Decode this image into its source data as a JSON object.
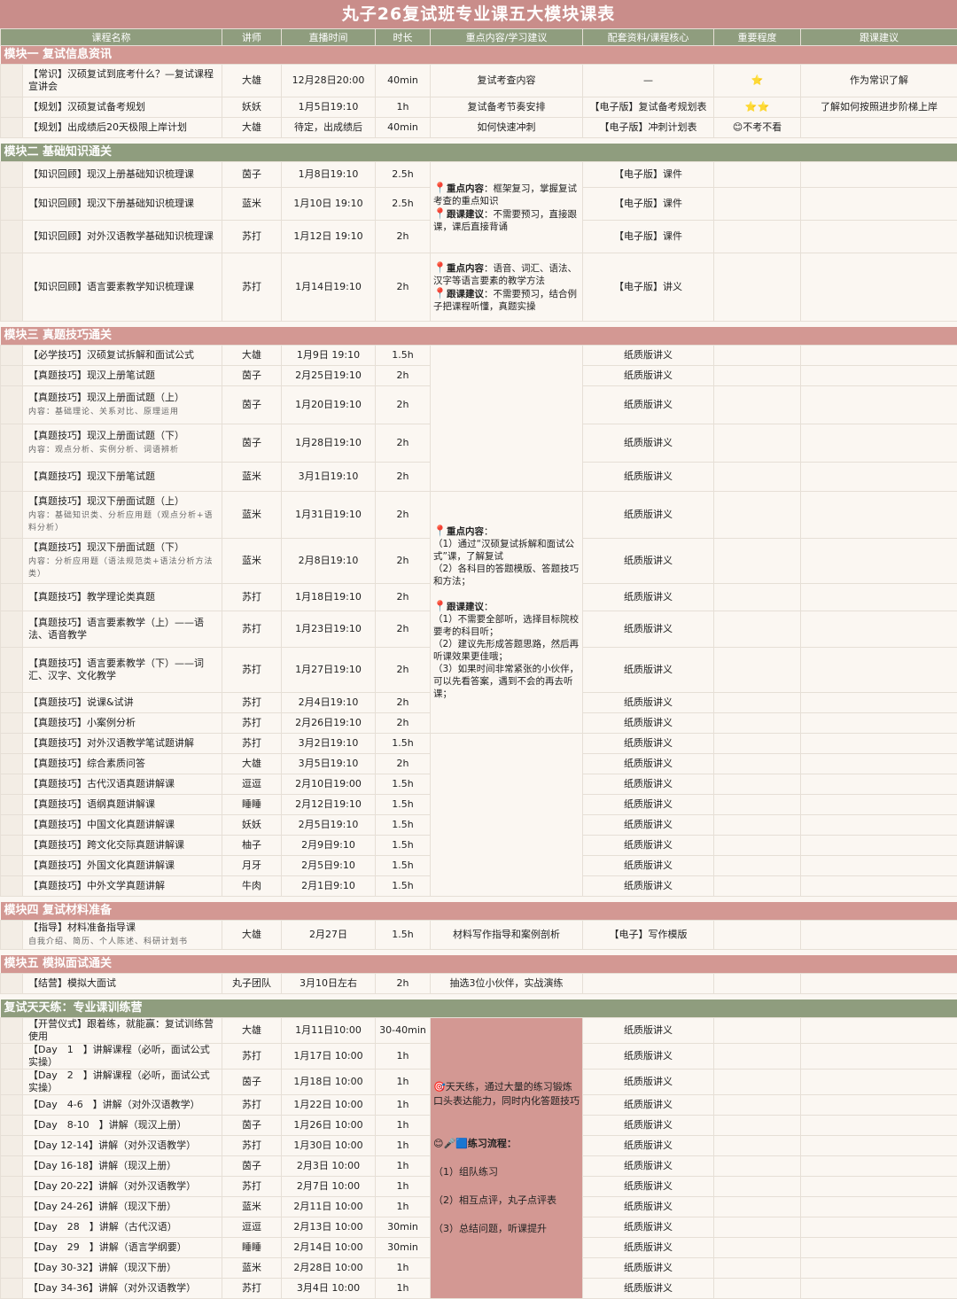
{
  "title": "丸子26复试班专业课五大模块课表",
  "headers": [
    "课程名称",
    "讲师",
    "直播时间",
    "时长",
    "重点内容/学习建议",
    "配套资料/课程核心",
    "重要程度",
    "跟课建议"
  ],
  "module1": {
    "title": "模块一  复试信息资讯",
    "rows": [
      {
        "name": "【常识】汉硕复试到底考什么？—复试课程宣讲会",
        "teacher": "大雄",
        "time": "12月28日20:00",
        "dur": "40min",
        "content": "复试考查内容",
        "material": "—",
        "importance": "⭐",
        "advice": "作为常识了解"
      },
      {
        "name": "【规划】汉硕复试备考规划",
        "teacher": "妖妖",
        "time": "1月5日19:10",
        "dur": "1h",
        "content": "复试备考节奏安排",
        "material": "【电子版】复试备考规划表",
        "importance": "⭐⭐",
        "advice": "了解如何按照进步阶梯上岸"
      },
      {
        "name": "【规划】出成绩后20天极限上岸计划",
        "teacher": "大雄",
        "time": "待定，出成绩后",
        "dur": "40min",
        "content": "如何快速冲刺",
        "material": "【电子版】冲刺计划表",
        "importance": "😊不考不看",
        "advice": ""
      }
    ]
  },
  "module2": {
    "title": "模块二  基础知识通关",
    "rows": [
      {
        "name": "【知识回顾】现汉上册基础知识梳理课",
        "teacher": "茵子",
        "time": "1月8日19:10",
        "dur": "2.5h",
        "material": "【电子版】课件"
      },
      {
        "name": "【知识回顾】现汉下册基础知识梳理课",
        "teacher": "蓝米",
        "time": "1月10日 19:10",
        "dur": "2.5h",
        "material": "【电子版】课件"
      },
      {
        "name": "【知识回顾】对外汉语教学基础知识梳理课",
        "teacher": "苏打",
        "time": "1月12日 19:10",
        "dur": "2h",
        "material": "【电子版】课件"
      },
      {
        "name": "【知识回顾】语言要素教学知识梳理课",
        "teacher": "苏打",
        "time": "1月14日19:10",
        "dur": "2h",
        "material": "【电子版】讲义"
      }
    ],
    "note1": {
      "k1": "重点内容",
      "v1": "：框架复习，掌握复试考查的重点知识",
      "k2": "跟课建议",
      "v2": "：不需要预习，直接跟课，课后直接背诵"
    },
    "note2": {
      "k1": "重点内容",
      "v1": "：语音、词汇、语法、汉字等语言要素的教学方法",
      "k2": "跟课建议",
      "v2": "：不需要预习，结合例子把课程听懂，真题实操"
    }
  },
  "module3": {
    "title": "模块三  真题技巧通关",
    "rows": [
      {
        "name": "【必学技巧】汉硕复试拆解和面试公式",
        "sub": "",
        "teacher": "大雄",
        "time": "1月9日 19:10",
        "dur": "1.5h",
        "material": "纸质版讲义"
      },
      {
        "name": "【真题技巧】现汉上册笔试题",
        "sub": "",
        "teacher": "茵子",
        "time": "2月25日19:10",
        "dur": "2h",
        "material": "纸质版讲义"
      },
      {
        "name": "【真题技巧】现汉上册面试题（上）",
        "sub": "内容：基础理论、关系对比、原理运用",
        "teacher": "茵子",
        "time": "1月20日19:10",
        "dur": "2h",
        "material": "纸质版讲义"
      },
      {
        "name": "【真题技巧】现汉上册面试题（下）",
        "sub": "内容：观点分析、实例分析、词语辨析",
        "teacher": "茵子",
        "time": "1月28日19:10",
        "dur": "2h",
        "material": "纸质版讲义"
      },
      {
        "name": "【真题技巧】现汉下册笔试题",
        "sub": "",
        "teacher": "蓝米",
        "time": "3月1日19:10",
        "dur": "2h",
        "material": "纸质版讲义"
      },
      {
        "name": "【真题技巧】现汉下册面试题（上）",
        "sub": "内容：基础知识类、分析应用题（观点分析+语料分析）",
        "teacher": "蓝米",
        "time": "1月31日19:10",
        "dur": "2h",
        "material": "纸质版讲义"
      },
      {
        "name": "【真题技巧】现汉下册面试题（下）",
        "sub": "内容：分析应用题（语法规范类+语法分析方法类）",
        "teacher": "蓝米",
        "time": "2月8日19:10",
        "dur": "2h",
        "material": "纸质版讲义"
      },
      {
        "name": "【真题技巧】教学理论类真题",
        "sub": "",
        "teacher": "苏打",
        "time": "1月18日19:10",
        "dur": "2h",
        "material": "纸质版讲义"
      },
      {
        "name": "【真题技巧】语言要素教学（上）——语法、语音教学",
        "sub": "",
        "teacher": "苏打",
        "time": "1月23日19:10",
        "dur": "2h",
        "material": "纸质版讲义"
      },
      {
        "name": "【真题技巧】语言要素教学（下）——词汇、汉字、文化教学",
        "sub": "",
        "teacher": "苏打",
        "time": "1月27日19:10",
        "dur": "2h",
        "material": "纸质版讲义"
      },
      {
        "name": "【真题技巧】说课&试讲",
        "sub": "",
        "teacher": "苏打",
        "time": "2月4日19:10",
        "dur": "2h",
        "material": "纸质版讲义"
      },
      {
        "name": "【真题技巧】小案例分析",
        "sub": "",
        "teacher": "苏打",
        "time": "2月26日19:10",
        "dur": "2h",
        "material": "纸质版讲义"
      },
      {
        "name": "【真题技巧】对外汉语教学笔试题讲解",
        "sub": "",
        "teacher": "苏打",
        "time": "3月2日19:10",
        "dur": "1.5h",
        "material": "纸质版讲义"
      },
      {
        "name": "【真题技巧】综合素质问答",
        "sub": "",
        "teacher": "大雄",
        "time": "3月5日19:10",
        "dur": "2h",
        "material": "纸质版讲义"
      },
      {
        "name": "【真题技巧】古代汉语真题讲解课",
        "sub": "",
        "teacher": "逗逗",
        "time": "2月10日19:00",
        "dur": "1.5h",
        "material": "纸质版讲义"
      },
      {
        "name": "【真题技巧】语纲真题讲解课",
        "sub": "",
        "teacher": "睡睡",
        "time": "2月12日19:10",
        "dur": "1.5h",
        "material": "纸质版讲义"
      },
      {
        "name": "【真题技巧】中国文化真题讲解课",
        "sub": "",
        "teacher": "妖妖",
        "time": "2月5日19:10",
        "dur": "1.5h",
        "material": "纸质版讲义"
      },
      {
        "name": "【真题技巧】跨文化交际真题讲解课",
        "sub": "",
        "teacher": "柚子",
        "time": "2月9日9:10",
        "dur": "1.5h",
        "material": "纸质版讲义"
      },
      {
        "name": "【真题技巧】外国文化真题讲解课",
        "sub": "",
        "teacher": "月牙",
        "time": "2月5日9:10",
        "dur": "1.5h",
        "material": "纸质版讲义"
      },
      {
        "name": "【真题技巧】中外文学真题讲解",
        "sub": "",
        "teacher": "牛肉",
        "time": "2月1日9:10",
        "dur": "1.5h",
        "material": "纸质版讲义"
      }
    ],
    "note": {
      "k1": "重点内容",
      "l1": "（1）通过“汉硕复试拆解和面试公式”课，了解复试",
      "l2": "（2）各科目的答题模版、答题技巧和方法；",
      "k2": "跟课建议",
      "l3": "（1）不需要全部听，选择目标院校要考的科目听；",
      "l4": "（2）建议先形成答题思路，然后再听课效果更佳哦；",
      "l5": "（3）如果时间非常紧张的小伙伴，可以先看答案，遇到不会的再去听课；"
    }
  },
  "module4": {
    "title": "模块四  复试材料准备",
    "row": {
      "name": "【指导】材料准备指导课",
      "sub": "自我介绍、简历、个人陈述、科研计划书",
      "teacher": "大雄",
      "time": "2月27日",
      "dur": "1.5h",
      "content": "材料写作指导和案例剖析",
      "material": "【电子】写作模版"
    }
  },
  "module5": {
    "title": "模块五  模拟面试通关",
    "row": {
      "name": "【结营】模拟大面试",
      "teacher": "丸子团队",
      "time": "3月10日左右",
      "dur": "2h",
      "content": "抽选3位小伙伴，实战演练"
    }
  },
  "camp": {
    "title": "复试天天练：专业课训练营",
    "rows": [
      {
        "name": "【开营仪式】跟着练，就能赢：复试训练营使用",
        "teacher": "大雄",
        "time": "1月11日10:00",
        "dur": "30-40min",
        "material": "纸质版讲义"
      },
      {
        "name": "【Day　1　】讲解课程（必听，面试公式实操）",
        "teacher": "苏打",
        "time": "1月17日 10:00",
        "dur": "1h",
        "material": "纸质版讲义"
      },
      {
        "name": "【Day　2　】讲解课程（必听，面试公式实操）",
        "teacher": "茵子",
        "time": "1月18日 10:00",
        "dur": "1h",
        "material": "纸质版讲义"
      },
      {
        "name": "【Day　4-6　】讲解（对外汉语教学）",
        "teacher": "苏打",
        "time": "1月22日 10:00",
        "dur": "1h",
        "material": "纸质版讲义"
      },
      {
        "name": "【Day　8-10　】讲解（现汉上册）",
        "teacher": "茵子",
        "time": "1月26日 10:00",
        "dur": "1h",
        "material": "纸质版讲义"
      },
      {
        "name": "【Day 12-14】讲解（对外汉语教学）",
        "teacher": "苏打",
        "time": "1月30日 10:00",
        "dur": "1h",
        "material": "纸质版讲义"
      },
      {
        "name": "【Day 16-18】讲解（现汉上册）",
        "teacher": "茵子",
        "time": "2月3日 10:00",
        "dur": "1h",
        "material": "纸质版讲义"
      },
      {
        "name": "【Day 20-22】讲解（对外汉语教学）",
        "teacher": "苏打",
        "time": "2月7日 10:00",
        "dur": "1h",
        "material": "纸质版讲义"
      },
      {
        "name": "【Day 24-26】讲解（现汉下册）",
        "teacher": "蓝米",
        "time": "2月11日 10:00",
        "dur": "1h",
        "material": "纸质版讲义"
      },
      {
        "name": "【Day　28　】讲解（古代汉语）",
        "teacher": "逗逗",
        "time": "2月13日 10:00",
        "dur": "30min",
        "material": "纸质版讲义"
      },
      {
        "name": "【Day　29　】讲解（语言学纲要）",
        "teacher": "睡睡",
        "time": "2月14日 10:00",
        "dur": "30min",
        "material": "纸质版讲义"
      },
      {
        "name": "【Day 30-32】讲解（现汉下册）",
        "teacher": "蓝米",
        "time": "2月28日 10:00",
        "dur": "1h",
        "material": "纸质版讲义"
      },
      {
        "name": "【Day 34-36】讲解（对外汉语教学）",
        "teacher": "苏打",
        "time": "3月4日 10:00",
        "dur": "1h",
        "material": "纸质版讲义"
      }
    ],
    "note": {
      "p1": "🎯天天练，通过大量的练习锻炼口头表达能力，同时内化答题技巧",
      "k": "😊🎤🟦练习流程：",
      "s1": "（1）组队练习",
      "s2": "（2）相互点评，丸子点评表",
      "s3": "（3）总结问题，听课提升"
    }
  },
  "colors": {
    "pink": "#d39893",
    "green": "#8f9d7e",
    "title": "#c98d8a"
  }
}
